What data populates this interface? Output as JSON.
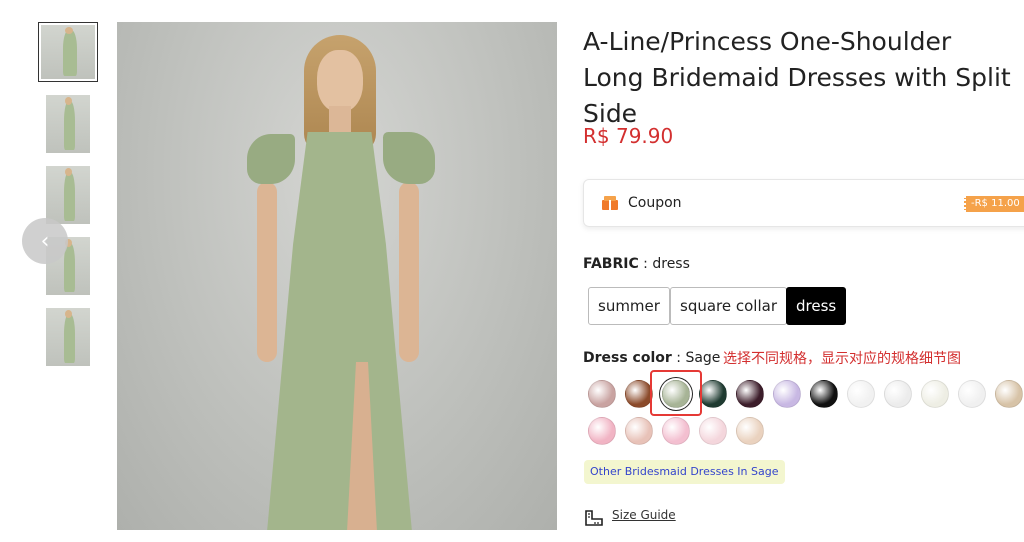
{
  "product": {
    "title": "A-Line/Princess One-Shoulder Long Bridemaid Dresses with Split Side",
    "price": "R$ 79.90"
  },
  "gallery": {
    "thumbnails": [
      "thumb-1",
      "thumb-2",
      "thumb-3",
      "thumb-4",
      "thumb-5"
    ],
    "prev_icon": "chevron-left-icon"
  },
  "coupon": {
    "label": "Coupon",
    "tag": "-R$ 11.00",
    "icon": "coupon-icon"
  },
  "fabric": {
    "label": "FABRIC",
    "separator": " : ",
    "value": "dress",
    "options": [
      "summer",
      "square collar",
      "dress"
    ],
    "selected": "dress"
  },
  "color": {
    "label": "Dress color",
    "separator": " : ",
    "value": "Sage",
    "annotation": "选择不同规格，显示对应的规格细节图",
    "swatches": [
      "#c9a3a1",
      "#8b4a2a",
      "#a7b496",
      "#1f3b31",
      "#3c1d2a",
      "#c8b8e3",
      "#111111",
      "#f1f1f1",
      "#ececec",
      "#eeeee4",
      "#f0f0f0",
      "#d7c3a7",
      "#f1b4c4",
      "#e8c2b8",
      "#f3bfd0",
      "#f4d6dc",
      "#ead2bf"
    ],
    "selected_index": 2
  },
  "other_link": "Other Bridesmaid Dresses In Sage",
  "size_guide": {
    "label": "Size Guide",
    "icon": "ruler-icon"
  },
  "colors": {
    "price": "#d32f2f",
    "annotation": "#d32f2f",
    "coupon_tag": "#f5a24a",
    "selected_option": "#000000",
    "link": "#3344cc"
  }
}
